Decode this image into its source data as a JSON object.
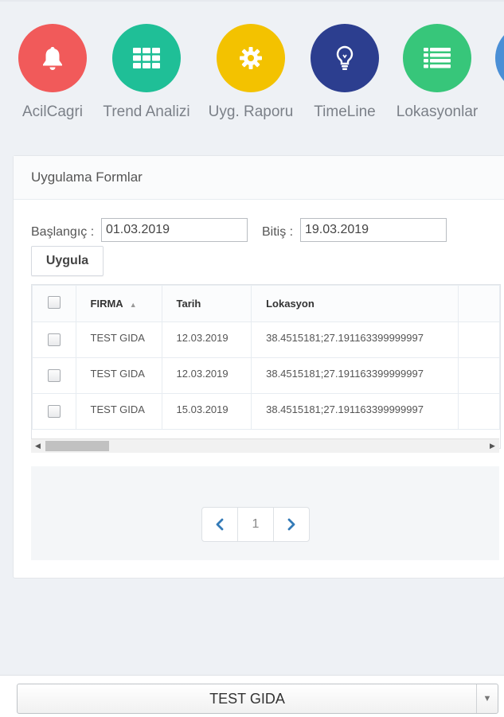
{
  "toolbar": {
    "items": [
      {
        "label": "AcilCagri",
        "icon": "bell-icon",
        "color": "#f15a5a"
      },
      {
        "label": "Trend Analizi",
        "icon": "grid-icon",
        "color": "#1fbf97"
      },
      {
        "label": "Uyg. Raporu",
        "icon": "gear-icon",
        "color": "#f3c200"
      },
      {
        "label": "TimeLine",
        "icon": "lightbulb-icon",
        "color": "#2c3e8f"
      },
      {
        "label": "Lokasyonlar",
        "icon": "list-icon",
        "color": "#37c67a"
      },
      {
        "label": "",
        "icon": "partial-icon",
        "color": "#4a8fd6"
      }
    ]
  },
  "portlet": {
    "title": "Uygulama Formlar",
    "filter": {
      "start_label": "Başlangıç :",
      "start_value": "01.03.2019",
      "end_label": "Bitiş :",
      "end_value": "19.03.2019",
      "apply_label": "Uygula"
    },
    "table": {
      "columns": [
        "FIRMA",
        "Tarih",
        "Lokasyon"
      ],
      "rows": [
        {
          "firma": "TEST GIDA",
          "tarih": "12.03.2019",
          "lokasyon": "38.4515181;27.191163399999997"
        },
        {
          "firma": "TEST GIDA",
          "tarih": "12.03.2019",
          "lokasyon": "38.4515181;27.191163399999997"
        },
        {
          "firma": "TEST GIDA",
          "tarih": "15.03.2019",
          "lokasyon": "38.4515181;27.191163399999997"
        }
      ]
    },
    "pagination": {
      "prev": "‹",
      "page": "1",
      "next": "›"
    }
  },
  "bottom_select": {
    "value": "TEST GIDA"
  },
  "colors": {
    "accent_link": "#337ab7"
  }
}
